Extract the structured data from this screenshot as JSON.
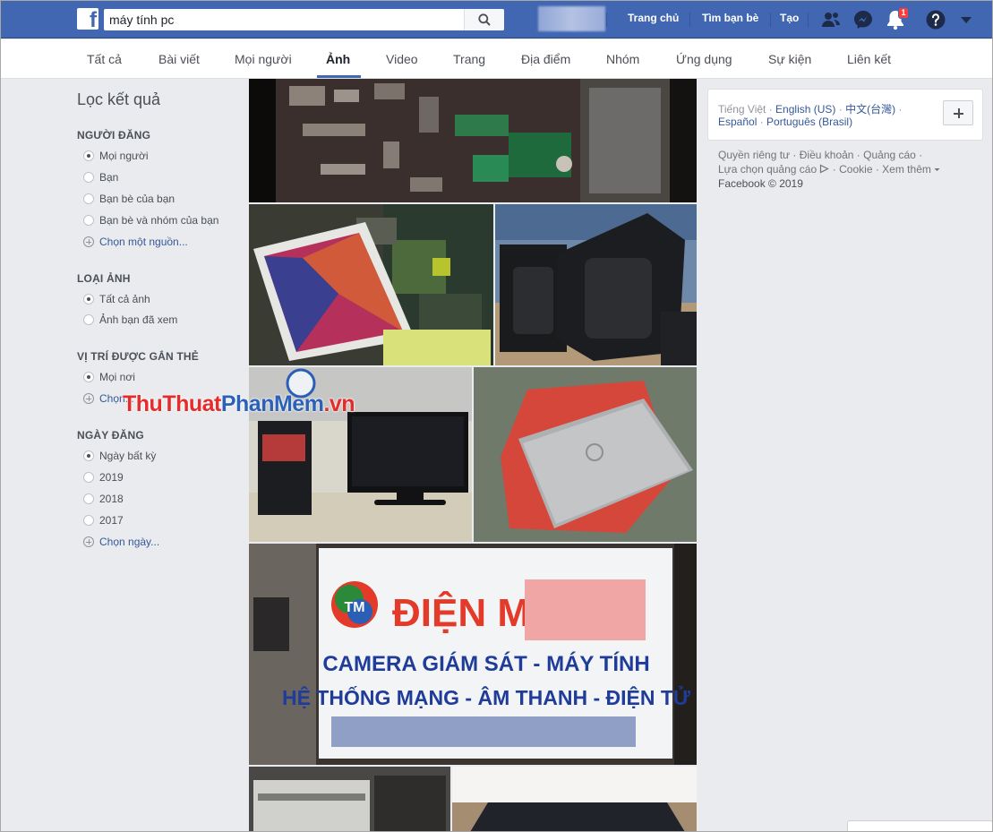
{
  "colors": {
    "brand": "#4267b2",
    "link": "#365899",
    "badge": "#fa3e3e",
    "watermark_red": "#e52b2b",
    "watermark_blue": "#2b61b8"
  },
  "search": {
    "query": "máy tính pc",
    "icon": "search-icon"
  },
  "topnav": {
    "home": "Trang chủ",
    "find_friends": "Tìm bạn bè",
    "create": "Tạo",
    "notification_count": "1",
    "icons": [
      "friend-requests-icon",
      "messenger-icon",
      "bell-icon",
      "help-icon",
      "caret-down-icon"
    ]
  },
  "tabs": [
    {
      "label": "Tất cả"
    },
    {
      "label": "Bài viết"
    },
    {
      "label": "Mọi người"
    },
    {
      "label": "Ảnh",
      "active": true
    },
    {
      "label": "Video"
    },
    {
      "label": "Trang"
    },
    {
      "label": "Địa điểm"
    },
    {
      "label": "Nhóm"
    },
    {
      "label": "Ứng dụng"
    },
    {
      "label": "Sự kiện"
    },
    {
      "label": "Liên kết"
    }
  ],
  "filters": {
    "title": "Lọc kết quả",
    "sections": [
      {
        "title": "NGƯỜI ĐĂNG",
        "options": [
          {
            "label": "Mọi người",
            "selected": true
          },
          {
            "label": "Bạn",
            "selected": false
          },
          {
            "label": "Bạn bè của bạn",
            "selected": false
          },
          {
            "label": "Bạn bè và nhóm của bạn",
            "selected": false
          }
        ],
        "more": "Chọn một nguồn..."
      },
      {
        "title": "LOẠI ẢNH",
        "options": [
          {
            "label": "Tất cả ảnh",
            "selected": true
          },
          {
            "label": "Ảnh bạn đã xem",
            "selected": false
          }
        ]
      },
      {
        "title": "VỊ TRÍ ĐƯỢC GẮN THẺ",
        "options": [
          {
            "label": "Mọi nơi",
            "selected": true
          }
        ],
        "more": "Chọn..."
      },
      {
        "title": "NGÀY ĐĂNG",
        "options": [
          {
            "label": "Ngày bất kỳ",
            "selected": true
          },
          {
            "label": "2019",
            "selected": false
          },
          {
            "label": "2018",
            "selected": false
          },
          {
            "label": "2017",
            "selected": false
          }
        ],
        "more": "Chọn ngày..."
      }
    ]
  },
  "watermark": {
    "part1": "ThuThuat",
    "part2": "PhanMem",
    "part3": ".vn"
  },
  "photos": {
    "sign": {
      "logo": "TM",
      "heading": "ĐIỆN MÁY",
      "line1": "CAMERA GIÁM SÁT - MÁY TÍNH",
      "line2": "HỆ THỐNG MẠNG - ÂM THANH - ĐIỆN TỬ"
    }
  },
  "languages": {
    "current": "Tiếng Việt",
    "options": [
      "English (US)",
      "中文(台灣)",
      "Español",
      "Português (Brasil)"
    ],
    "add_label": "+"
  },
  "footer": {
    "links1": [
      "Quyền riêng tư",
      "Điều khoản",
      "Quảng cáo"
    ],
    "links2": [
      "Lựa chọn quảng cáo",
      "Cookie",
      "Xem thêm"
    ],
    "copyright": "Facebook © 2019"
  }
}
